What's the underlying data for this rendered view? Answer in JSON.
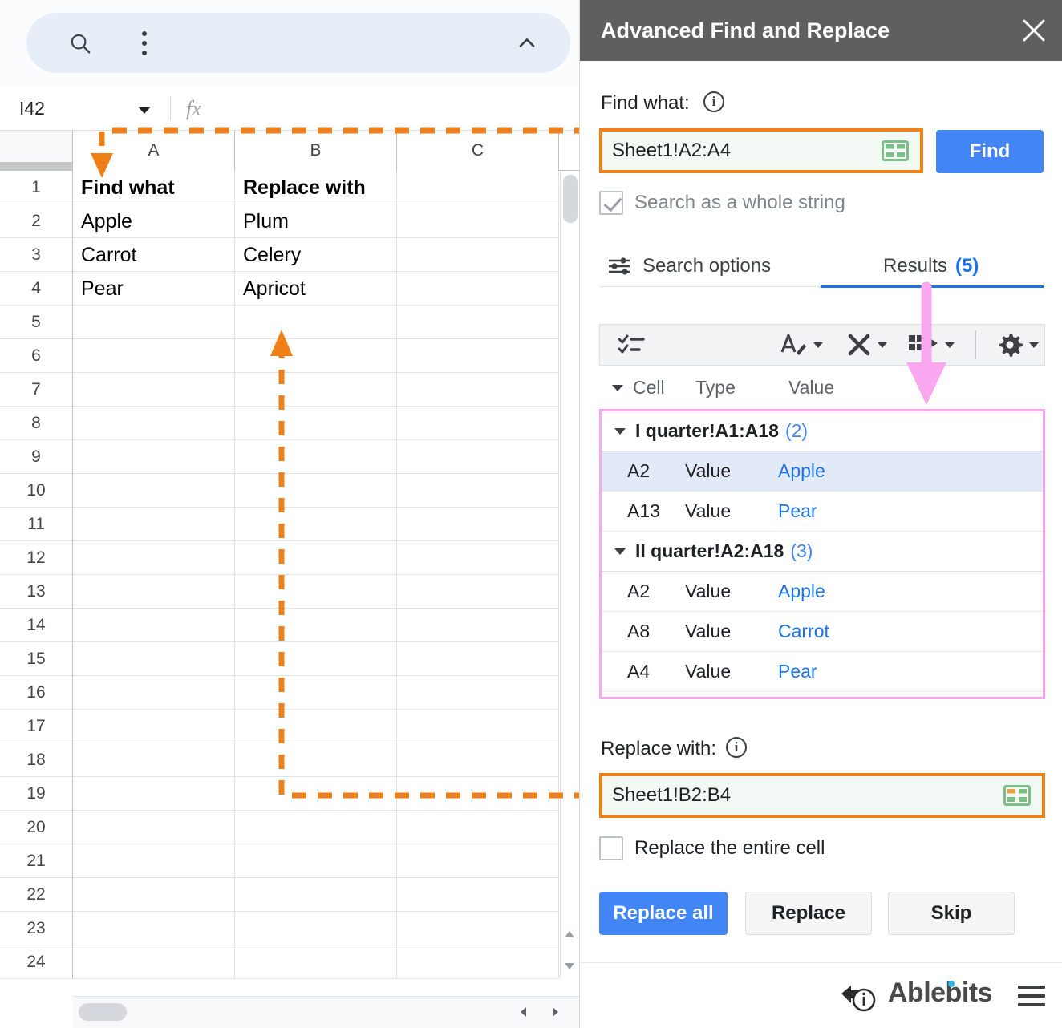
{
  "sheet": {
    "search_icon": "search-icon",
    "more_icon": "kebab-menu-icon",
    "collapse_icon": "chevron-up-icon",
    "name_box_value": "I42",
    "formula_icon": "fx",
    "formula_value": "",
    "columns": [
      "A",
      "B",
      "C"
    ],
    "rows": [
      "1",
      "2",
      "3",
      "4",
      "5",
      "6",
      "7",
      "8",
      "9",
      "10",
      "11",
      "12",
      "13",
      "14",
      "15",
      "16",
      "17",
      "18",
      "19",
      "20",
      "21",
      "22",
      "23",
      "24"
    ],
    "cells": [
      {
        "row": 1,
        "a": "Find what",
        "b": "Replace with",
        "bold": true
      },
      {
        "row": 2,
        "a": "Apple",
        "b": "Plum",
        "bold": false
      },
      {
        "row": 3,
        "a": "Carrot",
        "b": "Celery",
        "bold": false
      },
      {
        "row": 4,
        "a": "Pear",
        "b": "Apricot",
        "bold": false
      }
    ]
  },
  "panel": {
    "title": "Advanced Find and Replace",
    "close_label": "✕",
    "find_label": "Find what:",
    "find_value": "Sheet1!A2:A4",
    "find_button": "Find",
    "whole_string_label": "Search as a whole string",
    "whole_string_checked": true,
    "tabs": [
      {
        "label": "Search options",
        "active": false
      },
      {
        "label": "Results",
        "count": "(5)",
        "active": true
      }
    ],
    "toolbar": [
      {
        "name": "select-all-results-icon",
        "has_caret": false
      },
      {
        "name": "highlight-icon",
        "has_caret": true
      },
      {
        "name": "clear-icon",
        "has_caret": true
      },
      {
        "name": "export-to-sheet-icon",
        "has_caret": true
      },
      {
        "name": "settings-gear-icon",
        "has_caret": true
      }
    ],
    "result_columns": [
      "Cell",
      "Type",
      "Value"
    ],
    "result_groups": [
      {
        "name": "I quarter!A1:A18",
        "count": "(2)",
        "rows": [
          {
            "cell": "A2",
            "type": "Value",
            "value": "Apple",
            "selected": true
          },
          {
            "cell": "A13",
            "type": "Value",
            "value": "Pear",
            "selected": false
          }
        ]
      },
      {
        "name": "II quarter!A2:A18",
        "count": "(3)",
        "rows": [
          {
            "cell": "A2",
            "type": "Value",
            "value": "Apple",
            "selected": false
          },
          {
            "cell": "A8",
            "type": "Value",
            "value": "Carrot",
            "selected": false
          },
          {
            "cell": "A4",
            "type": "Value",
            "value": "Pear",
            "selected": false
          }
        ]
      }
    ],
    "replace_label": "Replace with:",
    "replace_value": "Sheet1!B2:B4",
    "entire_cell_label": "Replace the entire cell",
    "entire_cell_checked": false,
    "buttons": {
      "replace_all": "Replace all",
      "replace": "Replace",
      "skip": "Skip"
    },
    "footer": {
      "brand": "Ablebits",
      "help_icon": "help-lifebuoy-icon",
      "menu_icon": "hamburger-menu-icon"
    }
  },
  "annotations": {
    "arrow_color": "#ef7f17",
    "highlight_color": "#f9a8f0",
    "accent_blue": "#4285f4",
    "link_blue": "#1a73e8"
  }
}
